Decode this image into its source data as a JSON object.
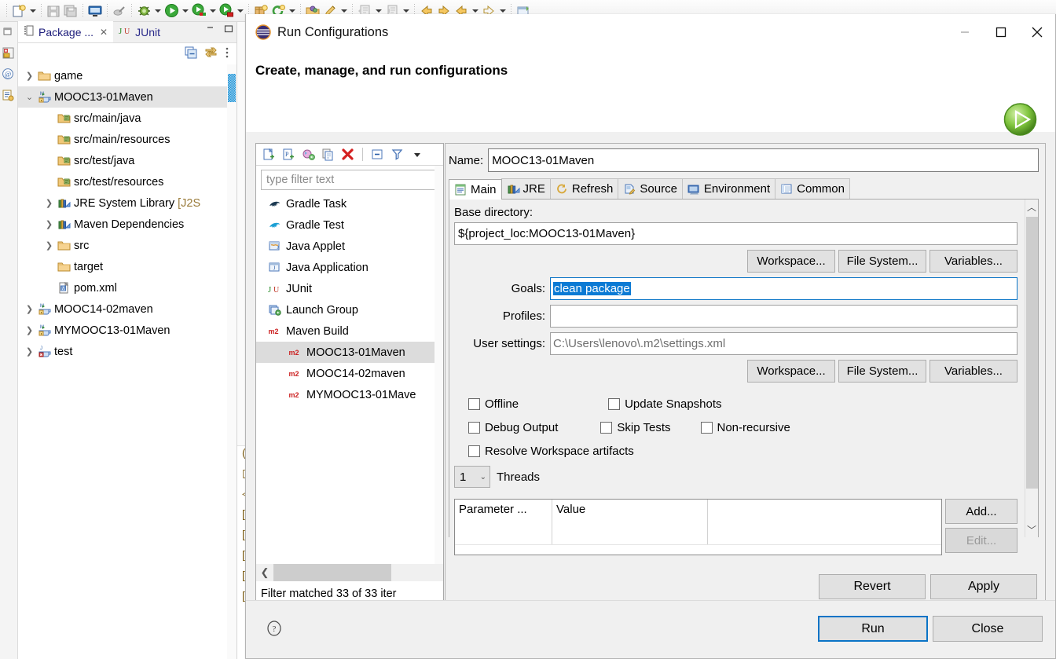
{
  "ide": {
    "toolbar_icons": [
      "new-icon",
      "new-dropdown",
      "save-icon",
      "save-all-icon",
      "console-icon",
      "disabled-link-icon",
      "debug-icon",
      "debug-dropdown",
      "run-icon",
      "run-dropdown",
      "coverage-icon",
      "coverage-dropdown",
      "run-external-icon",
      "run-external-dropdown",
      "new-java-project-icon",
      "refresh-icon",
      "refresh-dropdown",
      "open-package-icon",
      "annotate-icon",
      "annotate-dropdown",
      "download-icon",
      "download-dropdown",
      "upload-icon",
      "upload-dropdown",
      "back-arrow-icon",
      "forward-arrow-icon",
      "prev-annotation-icon",
      "prev-annotation-dropdown",
      "next-annotation-icon",
      "next-annotation-dropdown",
      "perspective-icon"
    ],
    "gutter_icons": [
      "restore-view-icon",
      "package-explorer-icon",
      "annotations-icon",
      "outline-icon"
    ],
    "views": {
      "active_tab": "Package ...",
      "inactive_tab": "JUnit",
      "toolbar_icons": [
        "collapse-all-icon",
        "link-with-editor-icon",
        "view-menu-icon"
      ],
      "window_buttons": [
        "minimize-icon",
        "maximize-icon"
      ]
    },
    "tree": [
      {
        "label": "game",
        "icon": "folder-icon",
        "indent": 0,
        "twisty": "collapsed",
        "selected": false
      },
      {
        "label": "MOOC13-01Maven",
        "icon": "maven-project-icon",
        "indent": 0,
        "twisty": "expanded",
        "selected": true
      },
      {
        "label": "src/main/java",
        "icon": "source-folder-icon",
        "indent": 1,
        "twisty": "none",
        "selected": false
      },
      {
        "label": "src/main/resources",
        "icon": "source-folder-icon",
        "indent": 1,
        "twisty": "none",
        "selected": false
      },
      {
        "label": "src/test/java",
        "icon": "source-folder-icon",
        "indent": 1,
        "twisty": "none",
        "selected": false
      },
      {
        "label": "src/test/resources",
        "icon": "source-folder-icon",
        "indent": 1,
        "twisty": "none",
        "selected": false
      },
      {
        "label": "JRE System Library ",
        "suffix": "[J2S",
        "icon": "library-icon",
        "indent": 1,
        "twisty": "collapsed",
        "selected": false
      },
      {
        "label": "Maven Dependencies",
        "icon": "library-icon",
        "indent": 1,
        "twisty": "collapsed",
        "selected": false
      },
      {
        "label": "src",
        "icon": "folder-icon",
        "indent": 1,
        "twisty": "collapsed",
        "selected": false
      },
      {
        "label": "target",
        "icon": "folder-icon",
        "indent": 1,
        "twisty": "none",
        "selected": false
      },
      {
        "label": "pom.xml",
        "icon": "xml-file-icon",
        "indent": 1,
        "twisty": "none",
        "selected": false
      },
      {
        "label": "MOOC14-02maven",
        "icon": "maven-project-icon",
        "indent": 0,
        "twisty": "collapsed",
        "selected": false
      },
      {
        "label": "MYMOOC13-01Maven",
        "icon": "maven-project-icon",
        "indent": 0,
        "twisty": "collapsed",
        "selected": false
      },
      {
        "label": "test",
        "icon": "error-project-icon",
        "indent": 0,
        "twisty": "collapsed",
        "selected": false
      }
    ]
  },
  "dialog": {
    "title": "Run Configurations",
    "icon": "eclipse-icon",
    "subtitle": "Create, manage, and run configurations",
    "run_orb_icon": "run-orb-icon",
    "window_buttons": [
      "minimize-icon",
      "maximize-icon",
      "close-icon"
    ],
    "config_panel": {
      "toolbar_icons": [
        "new-config-icon",
        "new-prototype-icon",
        "export-icon",
        "duplicate-icon",
        "delete-icon",
        "collapse-all-icon",
        "filter-icon",
        "view-menu-icon"
      ],
      "filter_placeholder": "type filter text",
      "items": [
        {
          "label": "Gradle Task",
          "icon": "gradle-task-icon",
          "level": 0,
          "selected": false
        },
        {
          "label": "Gradle Test",
          "icon": "gradle-test-icon",
          "level": 0,
          "selected": false
        },
        {
          "label": "Java Applet",
          "icon": "java-applet-icon",
          "level": 0,
          "selected": false
        },
        {
          "label": "Java Application",
          "icon": "java-application-icon",
          "level": 0,
          "selected": false
        },
        {
          "label": "JUnit",
          "icon": "junit-icon",
          "level": 0,
          "selected": false
        },
        {
          "label": "Launch Group",
          "icon": "launch-group-icon",
          "level": 0,
          "selected": false
        },
        {
          "label": "Maven Build",
          "icon": "maven-icon",
          "level": 0,
          "selected": false
        },
        {
          "label": "MOOC13-01Maven",
          "icon": "maven-icon",
          "level": 1,
          "selected": true
        },
        {
          "label": "MOOC14-02maven",
          "icon": "maven-icon",
          "level": 1,
          "selected": false
        },
        {
          "label": "MYMOOC13-01Mave",
          "icon": "maven-icon",
          "level": 1,
          "selected": false
        }
      ],
      "scroll_left_icon": "chevron-left-icon",
      "status": "Filter matched 33 of 33 iter"
    },
    "form": {
      "name_label": "Name:",
      "name_value": "MOOC13-01Maven",
      "tabs": [
        {
          "label": "Main",
          "icon": "main-tab-icon",
          "active": true
        },
        {
          "label": "JRE",
          "icon": "jre-tab-icon",
          "active": false
        },
        {
          "label": "Refresh",
          "icon": "refresh-tab-icon",
          "active": false
        },
        {
          "label": "Source",
          "icon": "source-tab-icon",
          "active": false
        },
        {
          "label": "Environment",
          "icon": "environment-tab-icon",
          "active": false
        },
        {
          "label": "Common",
          "icon": "common-tab-icon",
          "active": false
        }
      ],
      "base_directory_label": "Base directory:",
      "base_directory_value": "${project_loc:MOOC13-01Maven}",
      "base_dir_buttons": [
        "Workspace...",
        "File System...",
        "Variables..."
      ],
      "goals_label": "Goals:",
      "goals_value": "clean package",
      "goals_selected": true,
      "profiles_label": "Profiles:",
      "profiles_value": "",
      "user_settings_label": "User settings:",
      "user_settings_value": "C:\\Users\\lenovo\\.m2\\settings.xml",
      "user_settings_buttons": [
        "Workspace...",
        "File System...",
        "Variables..."
      ],
      "checkboxes": [
        [
          {
            "label": "Offline",
            "checked": false
          },
          {
            "label": "Update Snapshots",
            "checked": false
          }
        ],
        [
          {
            "label": "Debug Output",
            "checked": false
          },
          {
            "label": "Skip Tests",
            "checked": false
          },
          {
            "label": "Non-recursive",
            "checked": false
          }
        ],
        [
          {
            "label": "Resolve Workspace artifacts",
            "checked": false
          }
        ]
      ],
      "threads_value": "1",
      "threads_label": "Threads",
      "parameter_table": {
        "columns": [
          "Parameter ...",
          "Value",
          ""
        ],
        "rows": []
      },
      "table_buttons": [
        {
          "label": "Add...",
          "disabled": false
        },
        {
          "label": "Edit...",
          "disabled": true
        }
      ],
      "revert_label": "Revert",
      "apply_label": "Apply"
    },
    "footer": {
      "help_icon": "help-icon",
      "run_label": "Run",
      "close_label": "Close"
    }
  },
  "colors": {
    "accent": "#0b7ad4",
    "dialog_bg": "#f0f0f0",
    "selection_bg": "#0b7ad4",
    "tree_selection": "#e4e4e4"
  }
}
